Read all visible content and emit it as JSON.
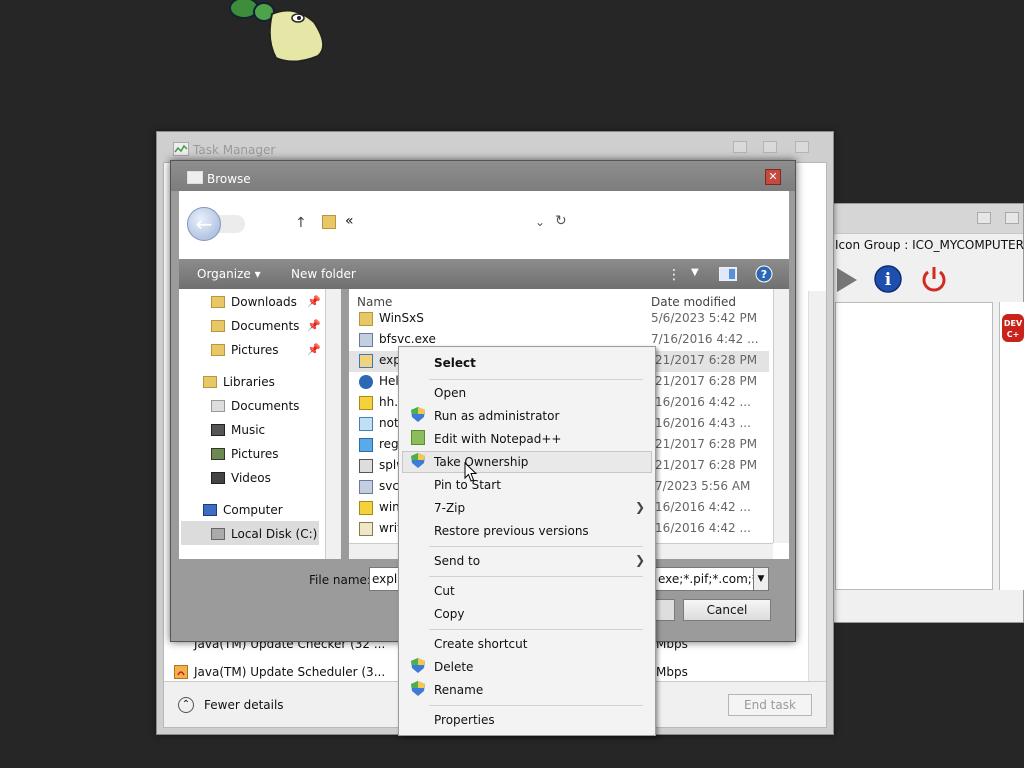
{
  "task_manager": {
    "title": "Task Manager",
    "rows": [
      {
        "name": "Java(TM) Update Checker (32 ...",
        "speed": "Mbps"
      },
      {
        "name": "Java(TM) Update Scheduler (3...",
        "speed": "Mbps"
      }
    ],
    "fewer_details": "Fewer details",
    "end_task": "End task"
  },
  "resource_window": {
    "icon_group": "Icon Group : ICO_MYCOMPUTER"
  },
  "browse": {
    "title": "Browse",
    "crumb": "«",
    "toolbar": {
      "organize": "Organize ▾",
      "new_folder": "New folder"
    },
    "nav": {
      "downloads": "Downloads",
      "documents": "Documents",
      "pictures": "Pictures",
      "libraries": "Libraries",
      "lib_documents": "Documents",
      "music": "Music",
      "lib_pictures": "Pictures",
      "videos": "Videos",
      "computer": "Computer",
      "local_disk": "Local Disk (C:)"
    },
    "columns": {
      "name": "Name",
      "date": "Date modified"
    },
    "files": [
      {
        "name": "WinSxS",
        "date": "5/6/2023 5:42 PM"
      },
      {
        "name": "bfsvc.exe",
        "date": "7/16/2016 4:42 ..."
      },
      {
        "name": "expl",
        "date": "/21/2017 6:28 PM"
      },
      {
        "name": "Help",
        "date": "/21/2017 6:28 PM"
      },
      {
        "name": "hh.e",
        "date": "/16/2016 4:42 ..."
      },
      {
        "name": "note",
        "date": "/16/2016 4:43 ..."
      },
      {
        "name": "rege",
        "date": "/21/2017 6:28 PM"
      },
      {
        "name": "splw",
        "date": "/21/2017 6:28 PM"
      },
      {
        "name": "svch",
        "date": "/7/2023 5:56 AM"
      },
      {
        "name": "winh",
        "date": "/16/2016 4:42 ..."
      },
      {
        "name": "writ",
        "date": "/16/2016 4:42 ..."
      }
    ],
    "file_name_label": "File name:",
    "file_name_value": "expl",
    "filter": "exe;*.pif;*.com;*.b",
    "cancel": "Cancel"
  },
  "context_menu": {
    "items": {
      "select": "Select",
      "open": "Open",
      "run_admin": "Run as administrator",
      "edit_npp": "Edit with Notepad++",
      "take_ownership": "Take Ownership",
      "pin_start": "Pin to Start",
      "zip": "7-Zip",
      "restore": "Restore previous versions",
      "send_to": "Send to",
      "cut": "Cut",
      "copy": "Copy",
      "create_shortcut": "Create shortcut",
      "delete": "Delete",
      "rename": "Rename",
      "properties": "Properties"
    },
    "highlighted": "Take Ownership"
  },
  "colors": {
    "desktop": "#262626",
    "accent_blue": "#2a67b4",
    "danger_red": "#c5493f"
  }
}
